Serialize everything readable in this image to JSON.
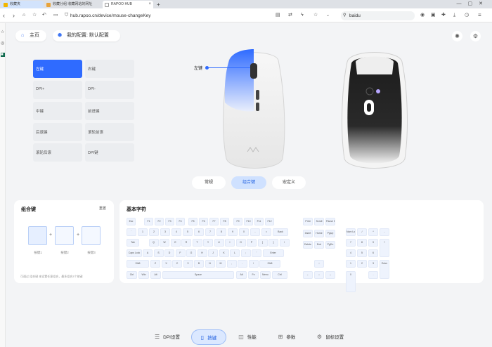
{
  "browser": {
    "tabs": [
      {
        "title": "收藏夹",
        "bg": "#d2e3fc"
      },
      {
        "title": "收藏分组 收藏网站的网址",
        "bg": "#dee1e6"
      },
      {
        "title": "RAPOO HUB",
        "bg": "#ffffff"
      }
    ],
    "new_tab": "+",
    "url": "hub.rapoo.cn/device/mouse-changeKey",
    "search_text": "baidu"
  },
  "header": {
    "home_label": "主页",
    "profile_label": "我的配置: 默认配置"
  },
  "buttons": [
    {
      "label": "左键",
      "active": true
    },
    {
      "label": "右键",
      "active": false
    },
    {
      "label": "DPI+",
      "active": false
    },
    {
      "label": "DPI-",
      "active": false
    },
    {
      "label": "中键",
      "active": false
    },
    {
      "label": "前进键",
      "active": false
    },
    {
      "label": "后退键",
      "active": false
    },
    {
      "label": "滚轮前滚",
      "active": false
    },
    {
      "label": "滚轮后滚",
      "active": false
    },
    {
      "label": "DPI键",
      "active": false
    }
  ],
  "mouse": {
    "callout_label": "左键"
  },
  "modes": [
    {
      "label": "常规",
      "active": false
    },
    {
      "label": "组合键",
      "active": true
    },
    {
      "label": "宏定义",
      "active": false
    }
  ],
  "combo": {
    "title": "组合键",
    "reset": "重置",
    "slots": [
      "按键1",
      "按键2",
      "按键3"
    ],
    "tip": "可通过 组合键 来设置任意组合，最多组合3个按键"
  },
  "keys_panel": {
    "title": "基本字符",
    "row_fn": [
      "Esc",
      "F1",
      "F2",
      "F3",
      "F4",
      "F5",
      "F6",
      "F7",
      "F8",
      "F9",
      "F10",
      "F11",
      "F12"
    ],
    "row_num": [
      "`",
      "1",
      "2",
      "3",
      "4",
      "5",
      "6",
      "7",
      "8",
      "9",
      "0",
      "-",
      "=",
      "Back"
    ],
    "row_tab": [
      "Tab",
      "Q",
      "W",
      "E",
      "R",
      "T",
      "Y",
      "U",
      "I",
      "O",
      "P",
      "[",
      "]",
      "\\"
    ],
    "row_caps": [
      "Caps Lock",
      "A",
      "S",
      "D",
      "F",
      "G",
      "H",
      "J",
      "K",
      "L",
      ";",
      "'",
      "Enter"
    ],
    "row_shift": [
      "Shift",
      "Z",
      "X",
      "C",
      "V",
      "B",
      "N",
      "M",
      ",",
      ".",
      "/",
      "Shift"
    ],
    "row_ctrl": [
      "Ctrl",
      "Win",
      "Alt",
      "Space",
      "Alt",
      "Fn",
      "Menu",
      "Ctrl"
    ],
    "nav_top": [
      "Print",
      "Scroll",
      "Pause Break"
    ],
    "nav_mid": [
      "Insert",
      "Home",
      "PgUp"
    ],
    "nav_bot": [
      "Delete",
      "End",
      "PgDn"
    ],
    "arrows": [
      "↑",
      "←",
      "↓",
      "→"
    ],
    "numpad": [
      "Num Lock",
      "/",
      "*",
      "-",
      "7",
      "8",
      "9",
      "+",
      "4",
      "5",
      "6",
      "1",
      "2",
      "3",
      "Enter",
      "0",
      "."
    ]
  },
  "bottom_nav": [
    {
      "label": "DPI设置",
      "icon": "sliders-icon",
      "active": false
    },
    {
      "label": "按键",
      "icon": "mouse-icon",
      "active": true
    },
    {
      "label": "性能",
      "icon": "gauge-icon",
      "active": false
    },
    {
      "label": "参数",
      "icon": "grid-icon",
      "active": false
    },
    {
      "label": "鼠标设置",
      "icon": "settings-icon",
      "active": false
    }
  ]
}
